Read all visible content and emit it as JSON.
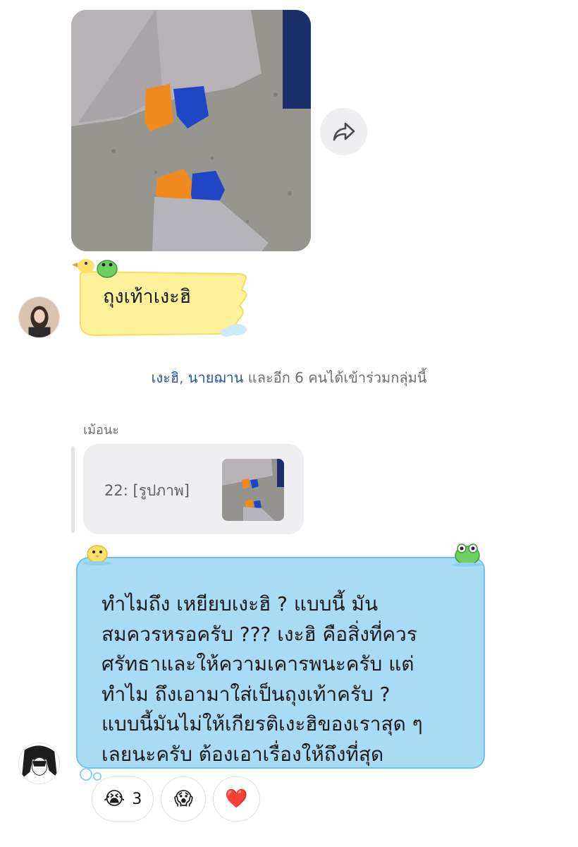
{
  "conversation": {
    "photo_message": {
      "image_desc": "photo of two pairs of feet wearing orange and blue socks",
      "share_icon": "share-arrow-icon"
    },
    "sticker_message": {
      "text": "ถุงเท้าเงะฮิ",
      "bubble_color": "#fdf29a"
    },
    "system_message": {
      "name_1": "เงะฮิ",
      "separator": ",",
      "name_2": "นายฌาน",
      "rest": "และอีก 6 คนได้เข้าร่วมกลุ่มนี้",
      "name_color": "#2b56a5"
    },
    "reply_message": {
      "sender": "เม้อนะ",
      "quoted_text": "22: [รูปภาพ]",
      "body_lines": [
        "ทำไมถึง เหยียบเงะฮิ ? แบบนี้ มัน",
        "สมควรหรอครับ ??? เงะฮิ คือสิ่งที่ควร",
        "ศรัทธาและให้ความเคารพนะครับ แต่",
        "ทำไม ถึงเอามาใส่เป็นถุงเท้าครับ ?",
        "แบบนี้มันไม่ให้เกียรติเงะฮิของเราสุด ๆ",
        "เลยนะครับ ต้องเอาเรื่องให้ถึงที่สุด"
      ],
      "bubble_color": "#a9dcf4"
    },
    "reactions": [
      {
        "emoji": "😭",
        "count": "3"
      },
      {
        "emoji": "😱",
        "count": ""
      },
      {
        "emoji": "❤️",
        "count": ""
      }
    ]
  }
}
